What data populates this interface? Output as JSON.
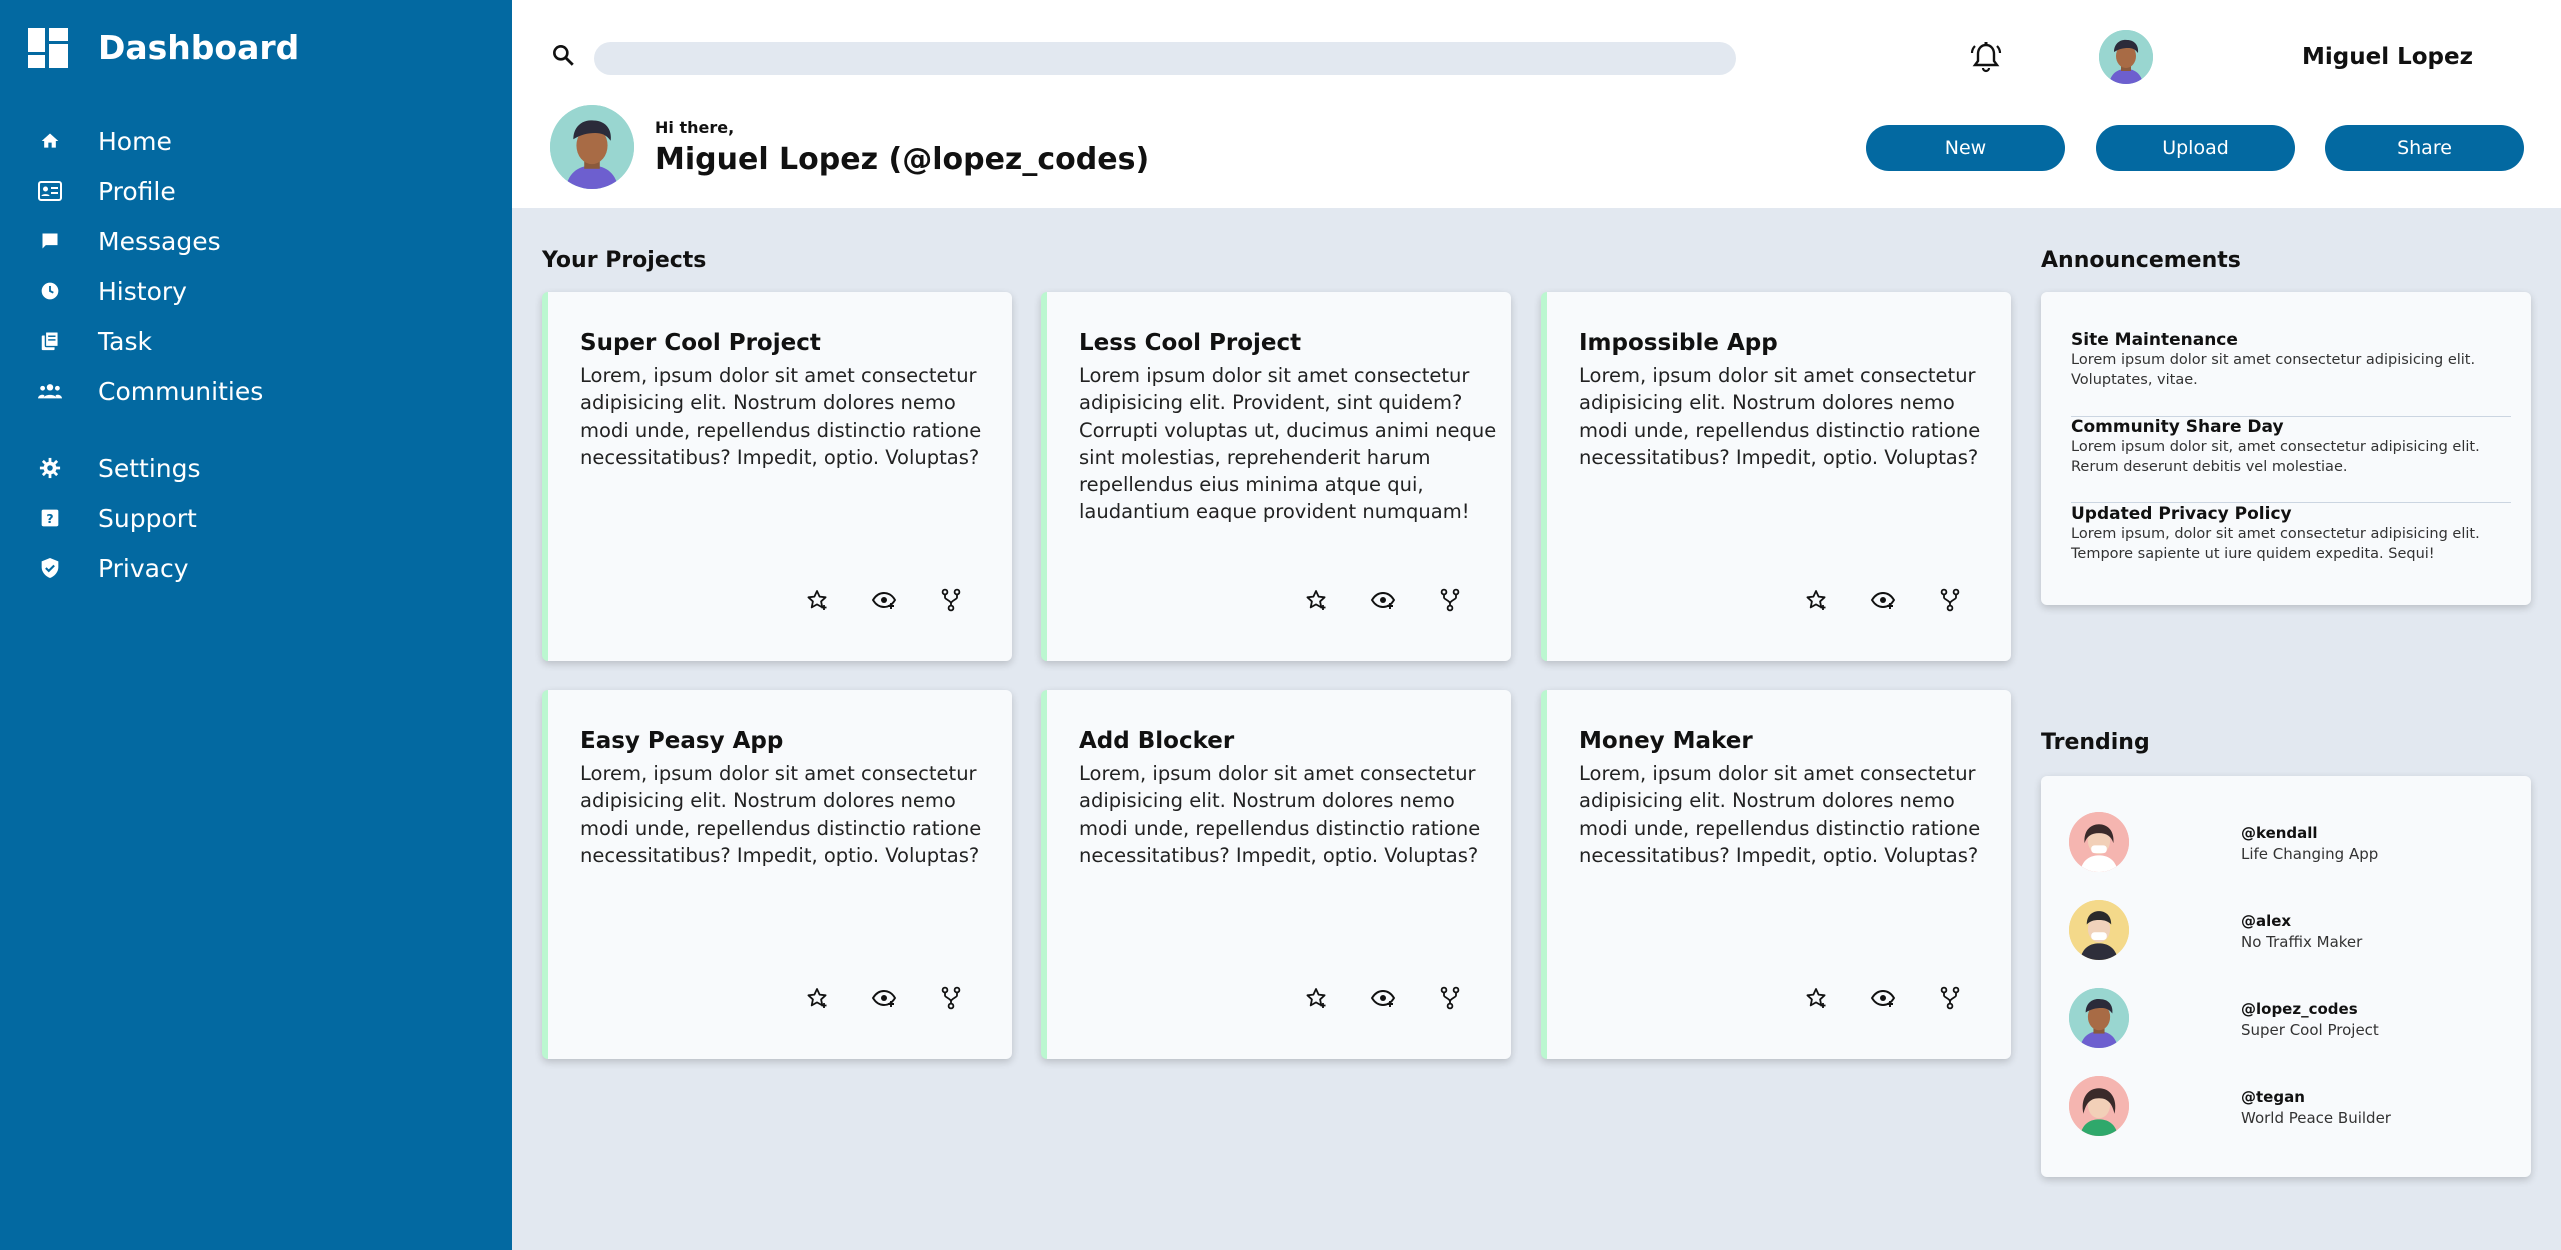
{
  "sidebar": {
    "title": "Dashboard",
    "items": [
      {
        "label": "Home",
        "icon": "home-icon"
      },
      {
        "label": "Profile",
        "icon": "id-card-icon"
      },
      {
        "label": "Messages",
        "icon": "message-icon"
      },
      {
        "label": "History",
        "icon": "clock-icon"
      },
      {
        "label": "Task",
        "icon": "task-icon"
      },
      {
        "label": "Communities",
        "icon": "group-icon"
      }
    ],
    "items2": [
      {
        "label": "Settings",
        "icon": "gear-icon"
      },
      {
        "label": "Support",
        "icon": "help-icon"
      },
      {
        "label": "Privacy",
        "icon": "shield-icon"
      }
    ]
  },
  "header": {
    "search": {
      "value": "",
      "placeholder": ""
    },
    "user_name": "Miguel Lopez",
    "greeting_small": "Hi there,",
    "greeting_big": "Miguel Lopez (@lopez_codes)",
    "buttons": {
      "new": "New",
      "upload": "Upload",
      "share": "Share"
    }
  },
  "projects": {
    "title": "Your Projects",
    "cards": [
      {
        "title": "Super Cool Project",
        "desc": "Lorem, ipsum dolor sit amet consectetur adipisicing elit. Nostrum dolores nemo modi unde, repellendus distinctio ratione necessitatibus? Impedit, optio. Voluptas?"
      },
      {
        "title": "Less Cool Project",
        "desc": "Lorem ipsum dolor sit amet consectetur adipisicing elit. Provident, sint quidem? Corrupti voluptas ut, ducimus animi neque sint molestias, reprehenderit harum repellendus eius minima atque qui, laudantium eaque provident numquam!"
      },
      {
        "title": "Impossible App",
        "desc": "Lorem, ipsum dolor sit amet consectetur adipisicing elit. Nostrum dolores nemo modi unde, repellendus distinctio ratione necessitatibus? Impedit, optio. Voluptas?"
      },
      {
        "title": "Easy Peasy App",
        "desc": "Lorem, ipsum dolor sit amet consectetur adipisicing elit. Nostrum dolores nemo modi unde, repellendus distinctio ratione necessitatibus? Impedit, optio. Voluptas?"
      },
      {
        "title": "Add Blocker",
        "desc": "Lorem, ipsum dolor sit amet consectetur adipisicing elit. Nostrum dolores nemo modi unde, repellendus distinctio ratione necessitatibus? Impedit, optio. Voluptas?"
      },
      {
        "title": "Money Maker",
        "desc": "Lorem, ipsum dolor sit amet consectetur adipisicing elit. Nostrum dolores nemo modi unde, repellendus distinctio ratione necessitatibus? Impedit, optio. Voluptas?"
      }
    ]
  },
  "announcements": {
    "title": "Announcements",
    "items": [
      {
        "title": "Site Maintenance",
        "text": "Lorem ipsum dolor sit amet consectetur adipisicing elit. Voluptates, vitae."
      },
      {
        "title": "Community Share Day",
        "text": "Lorem ipsum dolor sit, amet consectetur adipisicing elit. Rerum deserunt debitis vel molestiae."
      },
      {
        "title": "Updated Privacy Policy",
        "text": "Lorem ipsum, dolor sit amet consectetur adipisicing elit. Tempore sapiente ut iure quidem expedita. Sequi!"
      }
    ]
  },
  "trending": {
    "title": "Trending",
    "items": [
      {
        "handle": "@kendall",
        "project": "Life Changing App",
        "avatar_bg": "#f5b5b0"
      },
      {
        "handle": "@alex",
        "project": "No Traffix Maker",
        "avatar_bg": "#f4d98a"
      },
      {
        "handle": "@lopez_codes",
        "project": "Super Cool Project",
        "avatar_bg": "#99d6d0"
      },
      {
        "handle": "@tegan",
        "project": "World Peace Builder",
        "avatar_bg": "#f5b5b0"
      }
    ]
  },
  "colors": {
    "primary": "#0369a1",
    "background": "#e2e8f0",
    "card": "#f8fafc",
    "card_accent": "#bbf7d0"
  }
}
